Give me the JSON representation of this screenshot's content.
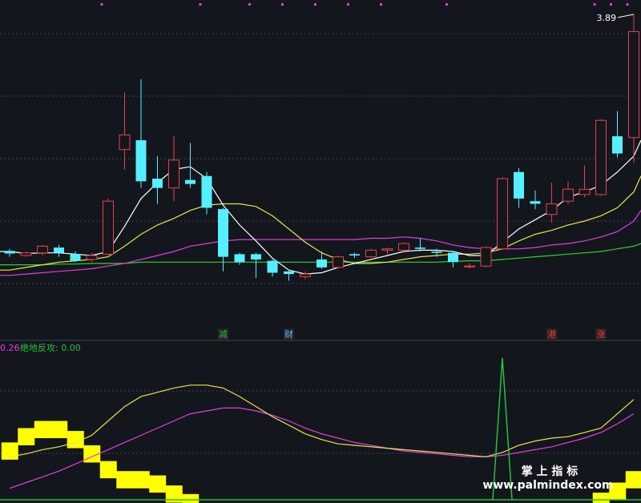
{
  "colors": {
    "background": "#14161d",
    "grid": "#3c4455",
    "up": "#e8424a",
    "down": "#54f0ff",
    "ma5": "#ffffff",
    "ma10": "#e6e64a",
    "ma20": "#e040e0",
    "ma60": "#30d030",
    "signal_yellow": "#ffff00",
    "signal_green": "#22c43a",
    "marker": "#e040e0",
    "watermark": "#ffffff"
  },
  "chart_data": [
    {
      "type": "candlestick",
      "max_label": "3.89",
      "max_value": 3.89,
      "ylim": [
        1.55,
        3.95
      ],
      "candles": [
        {
          "o": 2.105,
          "c": 2.085,
          "h": 2.12,
          "l": 2.06
        },
        {
          "o": 2.07,
          "c": 2.09,
          "h": 2.1,
          "l": 2.06
        },
        {
          "o": 2.09,
          "c": 2.14,
          "h": 2.15,
          "l": 2.07
        },
        {
          "o": 2.13,
          "c": 2.09,
          "h": 2.15,
          "l": 2.06
        },
        {
          "o": 2.08,
          "c": 2.03,
          "h": 2.1,
          "l": 2.02
        },
        {
          "o": 2.04,
          "c": 2.07,
          "h": 2.09,
          "l": 2.02
        },
        {
          "o": 2.08,
          "c": 2.48,
          "h": 2.5,
          "l": 2.07
        },
        {
          "o": 2.87,
          "c": 2.98,
          "h": 3.3,
          "l": 2.72
        },
        {
          "o": 2.94,
          "c": 2.63,
          "h": 3.4,
          "l": 2.58
        },
        {
          "o": 2.65,
          "c": 2.58,
          "h": 2.82,
          "l": 2.46
        },
        {
          "o": 2.58,
          "c": 2.79,
          "h": 2.97,
          "l": 2.48
        },
        {
          "o": 2.64,
          "c": 2.61,
          "h": 2.92,
          "l": 2.58
        },
        {
          "o": 2.67,
          "c": 2.43,
          "h": 2.7,
          "l": 2.38
        },
        {
          "o": 2.42,
          "c": 2.06,
          "h": 2.43,
          "l": 1.95
        },
        {
          "o": 2.08,
          "c": 2.02,
          "h": 2.09,
          "l": 2.0
        },
        {
          "o": 2.08,
          "c": 2.04,
          "h": 2.09,
          "l": 1.9
        },
        {
          "o": 2.03,
          "c": 1.94,
          "h": 2.04,
          "l": 1.91
        },
        {
          "o": 1.95,
          "c": 1.93,
          "h": 1.96,
          "l": 1.88
        },
        {
          "o": 1.91,
          "c": 1.93,
          "h": 1.95,
          "l": 1.89
        },
        {
          "o": 2.04,
          "c": 1.98,
          "h": 2.1,
          "l": 1.97
        },
        {
          "o": 1.98,
          "c": 2.06,
          "h": 2.07,
          "l": 1.97
        },
        {
          "o": 2.08,
          "c": 2.07,
          "h": 2.09,
          "l": 2.05
        },
        {
          "o": 2.06,
          "c": 2.11,
          "h": 2.12,
          "l": 2.05
        },
        {
          "o": 2.11,
          "c": 2.12,
          "h": 2.13,
          "l": 2.08
        },
        {
          "o": 2.11,
          "c": 2.16,
          "h": 2.17,
          "l": 2.1
        },
        {
          "o": 2.13,
          "c": 2.12,
          "h": 2.2,
          "l": 2.1
        },
        {
          "o": 2.1,
          "c": 2.09,
          "h": 2.12,
          "l": 2.06
        },
        {
          "o": 2.09,
          "c": 2.02,
          "h": 2.1,
          "l": 1.98
        },
        {
          "o": 1.99,
          "c": 1.99,
          "h": 2.01,
          "l": 1.97
        },
        {
          "o": 1.99,
          "c": 2.13,
          "h": 2.14,
          "l": 1.98
        },
        {
          "o": 2.12,
          "c": 2.65,
          "h": 2.66,
          "l": 2.11
        },
        {
          "o": 2.7,
          "c": 2.5,
          "h": 2.73,
          "l": 2.43
        },
        {
          "o": 2.48,
          "c": 2.46,
          "h": 2.56,
          "l": 2.42
        },
        {
          "o": 2.38,
          "c": 2.46,
          "h": 2.62,
          "l": 2.32
        },
        {
          "o": 2.48,
          "c": 2.57,
          "h": 2.63,
          "l": 2.46
        },
        {
          "o": 2.53,
          "c": 2.57,
          "h": 2.75,
          "l": 2.51
        },
        {
          "o": 2.53,
          "c": 3.09,
          "h": 3.1,
          "l": 2.52
        },
        {
          "o": 2.97,
          "c": 2.84,
          "h": 3.16,
          "l": 2.81
        },
        {
          "o": 2.96,
          "c": 3.76,
          "h": 3.89,
          "l": 2.77
        }
      ],
      "ma5": [
        2.1,
        2.085,
        2.09,
        2.09,
        2.08,
        2.07,
        2.1,
        2.29,
        2.5,
        2.62,
        2.72,
        2.74,
        2.65,
        2.45,
        2.3,
        2.18,
        2.05,
        1.96,
        1.93,
        1.94,
        1.98,
        2.01,
        2.04,
        2.07,
        2.1,
        2.11,
        2.11,
        2.1,
        2.07,
        2.07,
        2.17,
        2.27,
        2.34,
        2.41,
        2.51,
        2.55,
        2.6,
        2.7,
        2.82
      ],
      "ma10": [
        1.96,
        1.98,
        2.0,
        2.02,
        2.03,
        2.04,
        2.06,
        2.14,
        2.23,
        2.3,
        2.35,
        2.41,
        2.45,
        2.46,
        2.46,
        2.44,
        2.37,
        2.27,
        2.17,
        2.09,
        2.04,
        2.01,
        2.01,
        2.02,
        2.04,
        2.06,
        2.07,
        2.08,
        2.08,
        2.09,
        2.12,
        2.18,
        2.23,
        2.26,
        2.3,
        2.33,
        2.37,
        2.43,
        2.55
      ],
      "ma20": [
        1.92,
        1.93,
        1.94,
        1.95,
        1.96,
        1.97,
        1.99,
        2.01,
        2.04,
        2.07,
        2.1,
        2.14,
        2.16,
        2.18,
        2.19,
        2.19,
        2.19,
        2.19,
        2.19,
        2.19,
        2.19,
        2.19,
        2.2,
        2.2,
        2.21,
        2.2,
        2.18,
        2.15,
        2.13,
        2.12,
        2.12,
        2.12,
        2.13,
        2.15,
        2.16,
        2.18,
        2.21,
        2.25,
        2.33
      ],
      "ma60": [
        2.0,
        2.0,
        2.0,
        2.005,
        2.005,
        2.01,
        2.01,
        2.01,
        2.02,
        2.02,
        2.02,
        2.02,
        2.02,
        2.02,
        2.02,
        2.02,
        2.02,
        2.02,
        2.02,
        2.02,
        2.02,
        2.02,
        2.02,
        2.02,
        2.02,
        2.02,
        2.02,
        2.025,
        2.03,
        2.03,
        2.04,
        2.05,
        2.06,
        2.07,
        2.08,
        2.09,
        2.1,
        2.12,
        2.14
      ],
      "event_markers": [
        {
          "index": 13,
          "label": "减",
          "color": "#22c43a"
        },
        {
          "index": 17,
          "label": "财",
          "color": "#54c8ff"
        },
        {
          "index": 33,
          "label": "港",
          "color": "#e8424a"
        },
        {
          "index": 36,
          "label": "涨",
          "color": "#e8424a"
        }
      ]
    },
    {
      "type": "indicator",
      "legend_value": "0.26",
      "legend_label": "绝地反攻: 0.00",
      "ylim": [
        0,
        100
      ],
      "line_yellow": [
        30,
        32,
        35,
        37,
        40,
        45,
        55,
        65,
        72,
        75,
        78,
        80,
        80,
        78,
        72,
        65,
        58,
        52,
        46,
        42,
        39,
        38,
        37,
        36,
        35,
        34,
        33,
        32,
        31,
        30,
        33,
        38,
        41,
        43,
        44,
        47,
        50,
        60,
        70
      ],
      "line_magenta": [
        8,
        12,
        16,
        20,
        25,
        30,
        35,
        40,
        45,
        50,
        55,
        60,
        62,
        64,
        64,
        62,
        59,
        55,
        50,
        46,
        43,
        40,
        38,
        36,
        34,
        33,
        32,
        31,
        30,
        30,
        31,
        33,
        35,
        37,
        40,
        43,
        47,
        53,
        60
      ],
      "bars": [
        40,
        50,
        55,
        55,
        48,
        38,
        27,
        20,
        20,
        17,
        10,
        4,
        0,
        0,
        0,
        0,
        0,
        0,
        0,
        0,
        0,
        0,
        0,
        0,
        0,
        0,
        0,
        0,
        0,
        0,
        0,
        0,
        0,
        0,
        0,
        0,
        5,
        12,
        20
      ],
      "spike": {
        "index": 30,
        "value": 99
      }
    }
  ],
  "watermark": {
    "title": "掌 上 指 标",
    "url": "www.palmindex.com"
  }
}
